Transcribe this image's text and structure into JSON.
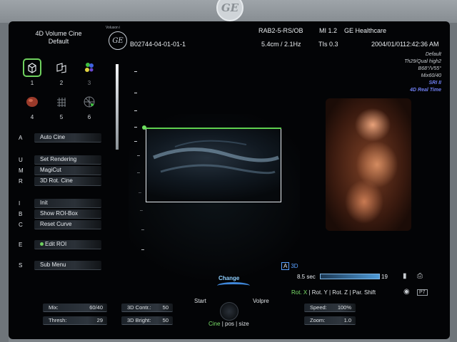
{
  "header": {
    "mode_title_line1": "4D Volume Cine",
    "mode_title_line2": "Default",
    "patient_id": "B02744-04-01-01-1",
    "probe": "RAB2-5-RS/OB",
    "mi": "MI  1.2",
    "manufacturer": "GE Healthcare",
    "depth_freq": "5.4cm / 2.1Hz",
    "tis": "TIs  0.3",
    "date": "2004/01/01",
    "time": "12:42:36 AM",
    "brand_small": "Voluson i"
  },
  "right_params": {
    "line1": "Default",
    "line2": "Th29/Qual high2",
    "line3": "B68°/V55°",
    "line4": "Mix60/40",
    "sri": "SRI II",
    "realtime": "4D Real Time"
  },
  "icons": [
    {
      "num": "1",
      "name": "cube-icon",
      "selected": true
    },
    {
      "num": "2",
      "name": "slice-icon",
      "selected": false
    },
    {
      "num": "3",
      "name": "color-balls-icon",
      "selected": false
    },
    {
      "num": "4",
      "name": "render-icon",
      "selected": false
    },
    {
      "num": "5",
      "name": "grid-icon",
      "selected": false
    },
    {
      "num": "6",
      "name": "globe-grid-icon",
      "selected": false
    }
  ],
  "menu": [
    {
      "key": "A",
      "label": "Auto Cine"
    },
    {
      "key": "U",
      "label": "Set Rendering"
    },
    {
      "key": "M",
      "label": "MagiCut"
    },
    {
      "key": "R",
      "label": "3D Rot. Cine"
    },
    {
      "key": "I",
      "label": "Init"
    },
    {
      "key": "B",
      "label": "Show ROI-Box"
    },
    {
      "key": "C",
      "label": "Reset Curve"
    },
    {
      "key": "E",
      "label": "Edit ROI"
    },
    {
      "key": "S",
      "label": "Sub Menu"
    }
  ],
  "view_toggle": {
    "a": "A",
    "b": "3D"
  },
  "cine": {
    "time": "8.5 sec",
    "frames": "19"
  },
  "rotation": {
    "x": "Rot. X",
    "y": "| Rot. Y",
    "z": "| Rot. Z",
    "par": "| Par. Shift"
  },
  "controls": {
    "change": "Change",
    "start": "Start",
    "volpre": "Volpre",
    "cine": "Cine",
    "pos": "| pos",
    "size": "| size"
  },
  "bottom": {
    "mix_label": "Mix:",
    "mix_value": "60/40",
    "thresh_label": "Thresh:",
    "thresh_value": "29",
    "contr_label": "3D Contr.:",
    "contr_value": "50",
    "bright_label": "3D Bright:",
    "bright_value": "50",
    "speed_label": "Speed:",
    "speed_value": "100%",
    "zoom_label": "Zoom:",
    "zoom_value": "1.0"
  },
  "side_icons": {
    "p7": "P7"
  }
}
